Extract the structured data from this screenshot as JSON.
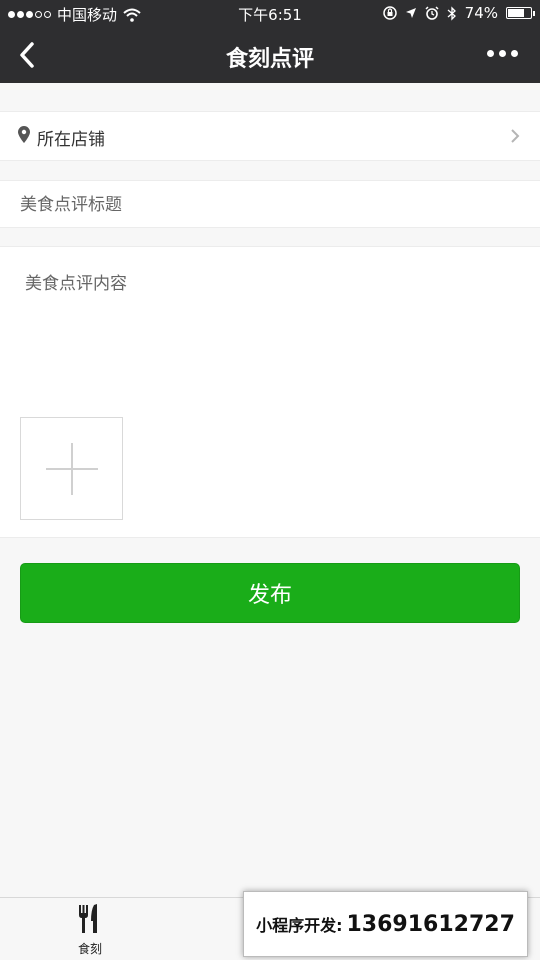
{
  "status_bar": {
    "carrier": "中国移动",
    "time": "下午6:51",
    "battery_percent": "74%",
    "battery_level": 0.74,
    "signal_icon": "signal-dots-icon",
    "wifi_icon": "wifi-icon",
    "lock_icon": "orientation-lock-icon",
    "location_icon": "location-arrow-icon",
    "alarm_icon": "alarm-icon",
    "bluetooth_icon": "bluetooth-icon"
  },
  "nav": {
    "title": "食刻点评",
    "back_icon": "chevron-left-icon",
    "more_icon": "more-dots-icon"
  },
  "form": {
    "shop_label": "所在店铺",
    "shop_icon": "location-pin-icon",
    "shop_chevron_icon": "chevron-right-icon",
    "title_placeholder": "美食点评标题",
    "content_placeholder": "美食点评内容",
    "add_photo_icon": "plus-icon"
  },
  "publish_label": "发布",
  "tabbar": {
    "tab1_label": "食刻",
    "tab1_icon": "fork-knife-icon"
  },
  "overlay": {
    "label": "小程序开发:",
    "phone": "13691612727"
  },
  "colors": {
    "navbar": "#2e2e30",
    "accent_green": "#1aad19",
    "page_bg": "#f7f7f7"
  }
}
